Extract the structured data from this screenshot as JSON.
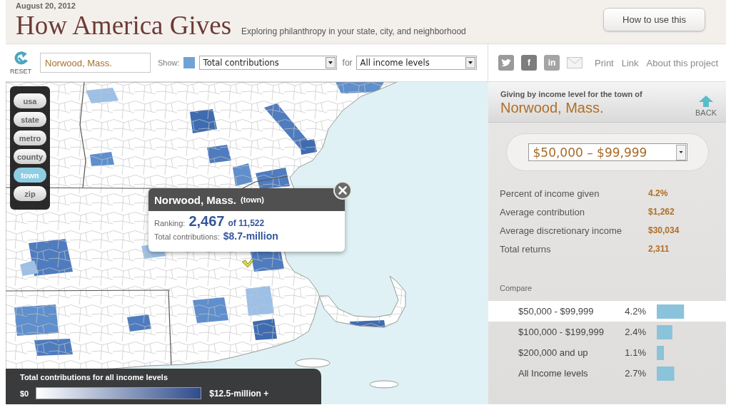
{
  "header": {
    "date": "August 20, 2012",
    "title": "How America Gives",
    "subtitle": "Exploring philanthropy in your state, city, and neighborhood",
    "help_button": "How to use this"
  },
  "toolbar": {
    "reset_label": "RESET",
    "location": {
      "value": "Norwood, Mass."
    },
    "show_label": "Show:",
    "measure_select": {
      "value": "Total contributions"
    },
    "for_label": "for",
    "income_select": {
      "value": "All income levels"
    },
    "share_icons": [
      {
        "kind": "bird"
      },
      {
        "kind": "letter",
        "glyph": "f"
      },
      {
        "kind": "letter",
        "glyph": "in"
      },
      {
        "kind": "envelope"
      }
    ],
    "links": [
      "Print",
      "Link",
      "About this project"
    ]
  },
  "map": {
    "levels": [
      {
        "label": "usa",
        "selected": false
      },
      {
        "label": "state",
        "selected": false
      },
      {
        "label": "metro",
        "selected": false
      },
      {
        "label": "county",
        "selected": false
      },
      {
        "label": "town",
        "selected": true
      },
      {
        "label": "zip",
        "selected": false
      }
    ],
    "popup": {
      "place": "Norwood, Mass.",
      "place_type": "(town)",
      "ranking_label": "Ranking:",
      "rank": "2,467",
      "rank_total": "of 11,522",
      "total_label": "Total contributions:",
      "total": "$8.7-million"
    },
    "legend": {
      "title": "Total contributions for all income levels",
      "min": "$0",
      "max": "$12.5-million +"
    }
  },
  "panel": {
    "heading": "Giving by income level for the town of",
    "place": "Norwood, Mass.",
    "back": "BACK",
    "income_select": {
      "value": "$50,000 – $99,999"
    },
    "stats": [
      {
        "label": "Percent of income given",
        "value": "4.2%"
      },
      {
        "label": "Average contribution",
        "value": "$1,262"
      },
      {
        "label": "Average discretionary income",
        "value": "$30,034"
      },
      {
        "label": "Total returns",
        "value": "2,311"
      }
    ],
    "compare_label": "Compare",
    "compare": {
      "rows": [
        {
          "selected": true
        },
        {
          "selected": false
        },
        {
          "selected": false
        },
        {
          "selected": false
        }
      ],
      "chart_data": {
        "type": "bar",
        "orientation": "horizontal",
        "categories": [
          "$50,000 - $99,999",
          "$100,000 - $199,999",
          "$200,000 and up",
          "All Income levels"
        ],
        "values": [
          4.2,
          2.4,
          1.1,
          2.7
        ],
        "value_labels": [
          "4.2%",
          "2.4%",
          "1.1%",
          "2.7%"
        ],
        "xlim": [
          0,
          4.4
        ]
      }
    }
  }
}
